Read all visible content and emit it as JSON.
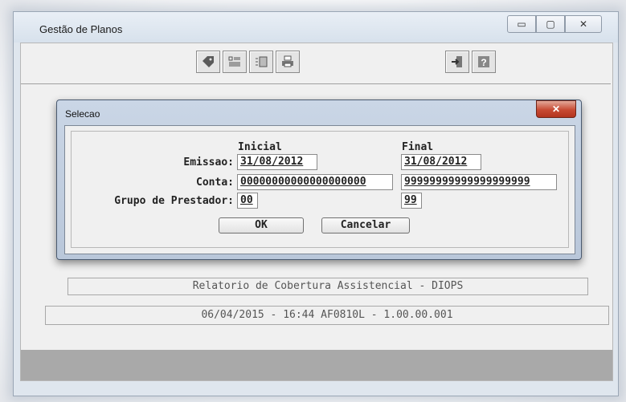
{
  "window": {
    "title": "Gestão de Planos",
    "controls": {
      "minimize": "▭",
      "maximize": "▢",
      "close": "✕"
    }
  },
  "toolbar": {
    "left_icons": [
      "tag-icon",
      "checklist-icon",
      "list-icon",
      "printer-icon"
    ],
    "right_icons": [
      "exit-door-icon",
      "help-icon"
    ]
  },
  "dialog": {
    "title": "Selecao",
    "close_label": "✕",
    "headers": {
      "inicial": "Inicial",
      "final": "Final"
    },
    "rows": [
      {
        "label": "Emissao:",
        "inicial": "31/08/2012",
        "final": "31/08/2012"
      },
      {
        "label": "Conta:",
        "inicial": "00000000000000000000",
        "final": "99999999999999999999"
      },
      {
        "label": "Grupo de Prestador:",
        "inicial": "00",
        "final": "99"
      }
    ],
    "ok_label": "OK",
    "cancel_label": "Cancelar"
  },
  "report_title": "Relatorio de Cobertura Assistencial - DIOPS",
  "status_line": "06/04/2015 - 16:44  AF0810L - 1.00.00.001"
}
